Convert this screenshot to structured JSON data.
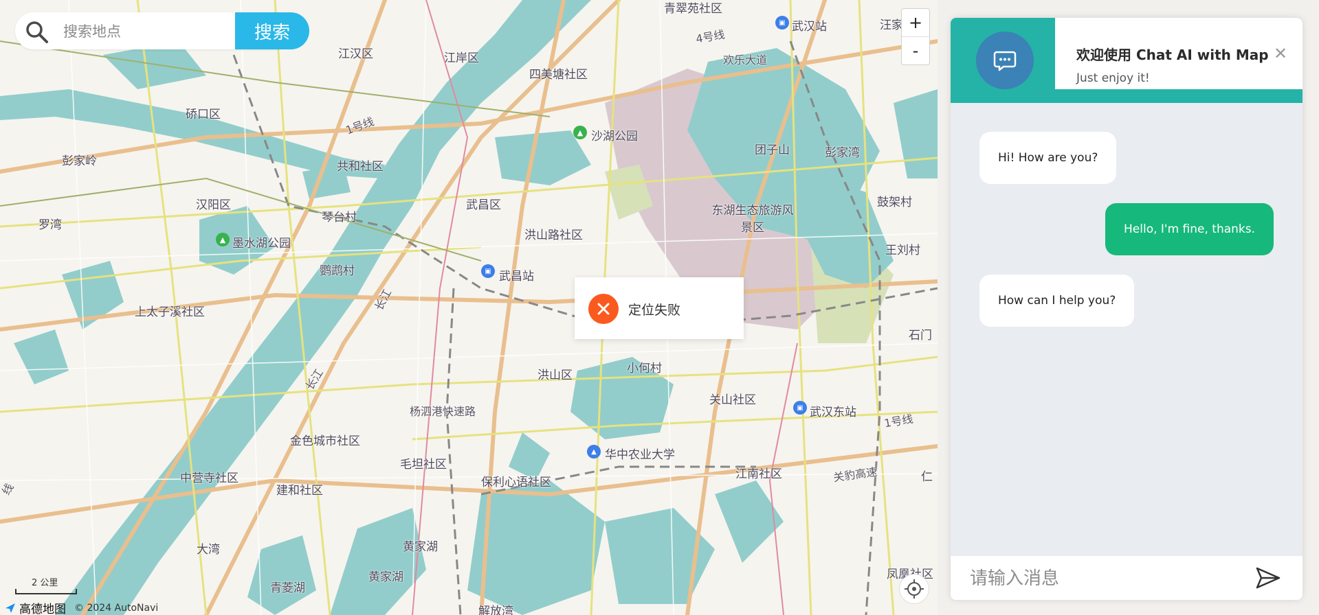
{
  "search": {
    "placeholder": "搜索地点",
    "button_label": "搜索"
  },
  "zoom": {
    "in_label": "+",
    "out_label": "-"
  },
  "map_labels": {
    "districts": [
      "江汉区",
      "江岸区",
      "四美塘社区",
      "硚口区",
      "彭家岭",
      "共和社区",
      "汉阳区",
      "琴台村",
      "罗湾",
      "鹦鹉村",
      "墨水湖公园",
      "上太子溪社区",
      "武昌区",
      "洪山路社区",
      "武昌站",
      "沙湖公园",
      "东湖生态旅游风景区",
      "团子山",
      "彭家湾",
      "鼓架村",
      "王刘村",
      "石门",
      "洪山区",
      "小何村",
      "关山社区",
      "武汉东站",
      "华中农业大学",
      "江南社区",
      "保利心语社区",
      "毛坦社区",
      "金色城市社区",
      "中营寺社区",
      "建和社区",
      "大湾",
      "黄家湖",
      "青菱湖",
      "黄家湖",
      "解放湾",
      "凤凰社区",
      "汪家",
      "青翠苑社区",
      "武汉站",
      "仁"
    ],
    "roads": [
      "长江",
      "长江",
      "1号线",
      "4号线",
      "欢乐大道",
      "杨泗港快速路",
      "关豹高速",
      "1号线",
      "线"
    ]
  },
  "scale": {
    "label": "2 公里"
  },
  "brand": {
    "name": "高德地图",
    "copyright": "© 2024 AutoNavi"
  },
  "toast": {
    "message": "定位失败"
  },
  "chat": {
    "title": "欢迎使用 Chat AI with Map",
    "subtitle": "Just enjoy it!",
    "messages": [
      {
        "role": "bot",
        "text": "Hi! How are you?"
      },
      {
        "role": "me",
        "text": "Hello, I'm fine, thanks."
      },
      {
        "role": "bot",
        "text": "How can I help you?"
      }
    ],
    "input_placeholder": "请输入消息"
  },
  "colors": {
    "accent": "#25b3a7",
    "search_button": "#2ab8e8",
    "user_bubble": "#16b87b",
    "error": "#fb5a1e",
    "water": "#92cdcb"
  },
  "icons": [
    "search-icon",
    "chat-bubble-icon",
    "close-icon",
    "send-icon",
    "locate-icon",
    "error-x-icon",
    "amap-logo-icon"
  ]
}
